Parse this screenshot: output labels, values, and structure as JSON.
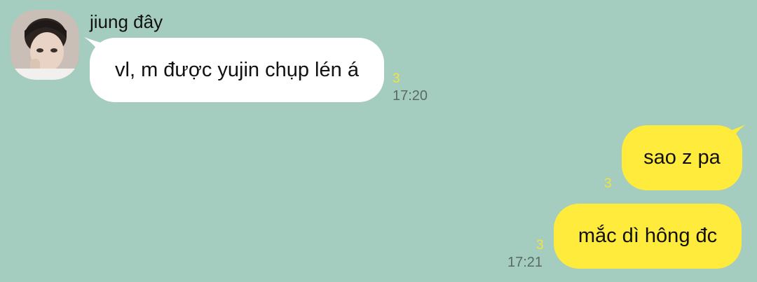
{
  "chat": {
    "sender_name": "jiung đây",
    "avatar_icon": "user-photo-avatar",
    "messages": [
      {
        "direction": "incoming",
        "text": "vl, m được yujin chụp lén á",
        "read_count": "3",
        "time": "17:20"
      },
      {
        "direction": "outgoing",
        "text": "sao z pa",
        "read_count": "3",
        "time": ""
      },
      {
        "direction": "outgoing",
        "text": "mắc dì hông đc",
        "read_count": "3",
        "time": "17:21"
      }
    ]
  },
  "colors": {
    "background": "#a4cdc0",
    "incoming_bubble": "#ffffff",
    "outgoing_bubble": "#ffeb3b",
    "read_count": "#f3e43b",
    "time": "#5a6a66"
  }
}
